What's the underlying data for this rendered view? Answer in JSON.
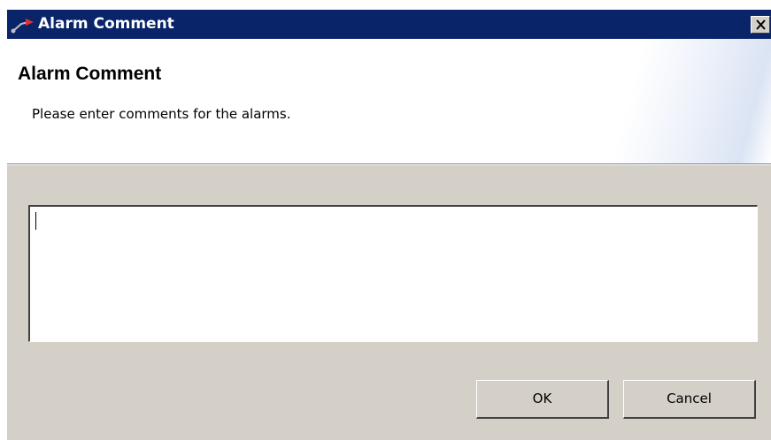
{
  "window": {
    "title": "Alarm Comment",
    "title_bar_color": "#0a246a",
    "close_label": "close"
  },
  "header": {
    "title": "Alarm Comment",
    "description": "Please enter comments for the alarms."
  },
  "comment": {
    "value": ""
  },
  "buttons": {
    "ok_label": "OK",
    "cancel_label": "Cancel"
  },
  "colors": {
    "dialog_background": "#d4d0c8",
    "header_background": "#ffffff"
  }
}
